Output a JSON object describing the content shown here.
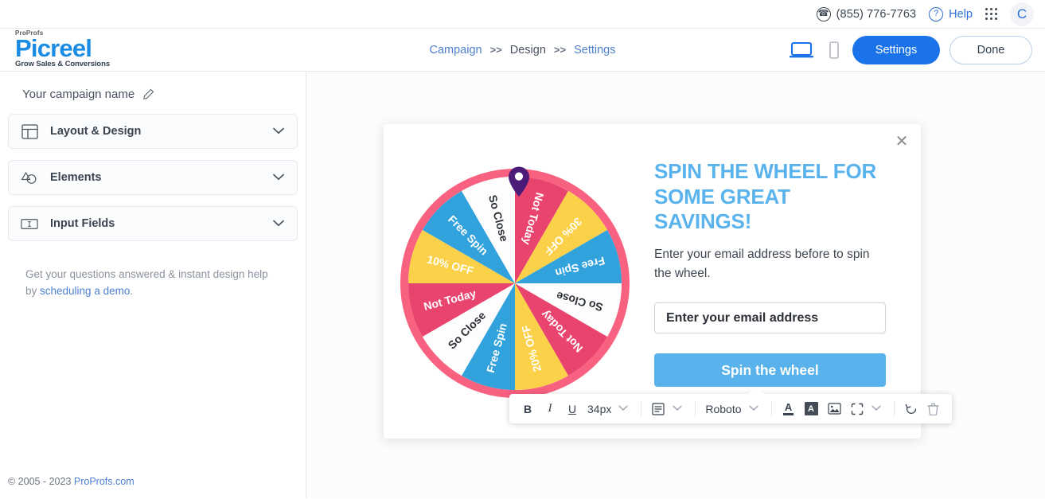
{
  "utility_bar": {
    "phone": "(855) 776-7763",
    "phone_icon": "phone-circle-icon",
    "help_label": "Help",
    "help_icon": "question-circle-icon",
    "apps_icon": "grid-apps-icon",
    "avatar_initial": "C"
  },
  "header": {
    "logo": {
      "sup": "ProProfs",
      "main": "Picreel",
      "sub": "Grow Sales & Conversions"
    },
    "breadcrumb": [
      {
        "label": "Campaign",
        "current": false
      },
      {
        "label": "Design",
        "current": true
      },
      {
        "label": "Settings",
        "current": false
      }
    ],
    "separator": ">>",
    "desktop_icon": "desktop-preview-icon",
    "mobile_icon": "mobile-preview-icon",
    "settings_label": "Settings",
    "done_label": "Done"
  },
  "sidebar": {
    "campaign_name": "Your campaign name",
    "edit_icon": "pencil-icon",
    "sections": [
      {
        "label": "Layout & Design",
        "icon": "layout-grid-icon"
      },
      {
        "label": "Elements",
        "icon": "shapes-icon"
      },
      {
        "label": "Input Fields",
        "icon": "text-input-icon"
      }
    ],
    "chevron_icon": "chevron-down-icon",
    "help_text": "Get your questions answered & instant design help by ",
    "help_link": "scheduling a demo",
    "help_period": ".",
    "footer_copyright": "© 2005 - 2023 ",
    "footer_link": "ProProfs.com"
  },
  "popup": {
    "close_icon": "close-icon",
    "headline": "SPIN THE WHEEL FOR SOME GREAT SAVINGS!",
    "subtext": "Enter your email address before to spin the wheel.",
    "email_placeholder": "Enter your email address",
    "email_value": "",
    "spin_button": "Spin the wheel",
    "headline_color": "#5ab3ec",
    "button_color": "#59b2eb"
  },
  "wheel": {
    "pointer_icon": "wheel-pointer-pin-icon",
    "rim_color": "#f8617f",
    "segment_colors": {
      "pink": "#e8446e",
      "yellow": "#fbd14a",
      "blue": "#32a2dc",
      "white": "#fdfdfd"
    },
    "segments": [
      {
        "label": "Not Today",
        "color": "#e8446e",
        "text_color": "#ffffff"
      },
      {
        "label": "30% OFF",
        "color": "#fbd14a",
        "text_color": "#ffffff"
      },
      {
        "label": "Free Spin",
        "color": "#32a2dc",
        "text_color": "#ffffff"
      },
      {
        "label": "So Close",
        "color": "#fdfdfd",
        "text_color": "#2b2f36"
      },
      {
        "label": "Not Today",
        "color": "#e8446e",
        "text_color": "#ffffff"
      },
      {
        "label": "20% OFF",
        "color": "#fbd14a",
        "text_color": "#ffffff"
      },
      {
        "label": "Free Spin",
        "color": "#32a2dc",
        "text_color": "#ffffff"
      },
      {
        "label": "So Close",
        "color": "#fdfdfd",
        "text_color": "#2b2f36"
      },
      {
        "label": "Not Today",
        "color": "#e8446e",
        "text_color": "#ffffff"
      },
      {
        "label": "10% OFF",
        "color": "#fbd14a",
        "text_color": "#ffffff"
      },
      {
        "label": "Free Spin",
        "color": "#32a2dc",
        "text_color": "#ffffff"
      },
      {
        "label": "So Close",
        "color": "#fdfdfd",
        "text_color": "#2b2f36"
      }
    ]
  },
  "toolbar": {
    "bold": "B",
    "italic": "I",
    "underline": "U",
    "font_size": "34px",
    "align_icon": "text-align-icon",
    "font_family": "Roboto",
    "text_color_icon": "text-color-icon",
    "highlight_icon": "highlight-color-icon",
    "image_icon": "insert-image-icon",
    "crop_icon": "crop-icon",
    "reset_icon": "reset-icon",
    "delete_icon": "trash-icon",
    "chevron_icon": "chevron-down-icon"
  }
}
